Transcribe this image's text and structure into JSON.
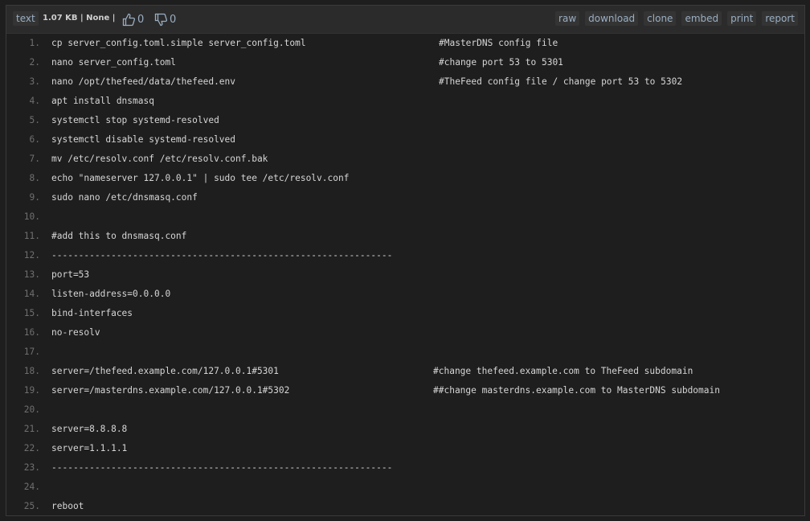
{
  "header": {
    "syntax_label": "text",
    "meta_text": "1.07 KB | None |",
    "like_count": "0",
    "dislike_count": "0",
    "actions": [
      "raw",
      "download",
      "clone",
      "embed",
      "print",
      "report"
    ]
  },
  "lines": [
    {
      "num": "1.",
      "code": "cp server_config.toml.simple server_config.toml",
      "comment": "#MasterDNS config file"
    },
    {
      "num": "2.",
      "code": "nano server_config.toml",
      "comment": "#change port 53 to 5301"
    },
    {
      "num": "3.",
      "code": "nano /opt/thefeed/data/thefeed.env",
      "comment": "#TheFeed config file / change port 53 to 5302"
    },
    {
      "num": "4.",
      "code": "apt install dnsmasq",
      "comment": ""
    },
    {
      "num": "5.",
      "code": "systemctl stop systemd-resolved",
      "comment": ""
    },
    {
      "num": "6.",
      "code": "systemctl disable systemd-resolved",
      "comment": ""
    },
    {
      "num": "7.",
      "code": "mv /etc/resolv.conf /etc/resolv.conf.bak",
      "comment": ""
    },
    {
      "num": "8.",
      "code": "echo \"nameserver 127.0.0.1\" | sudo tee /etc/resolv.conf",
      "comment": ""
    },
    {
      "num": "9.",
      "code": "sudo nano /etc/dnsmasq.conf",
      "comment": ""
    },
    {
      "num": "10.",
      "code": "",
      "comment": ""
    },
    {
      "num": "11.",
      "code": "#add this to dnsmasq.conf",
      "comment": ""
    },
    {
      "num": "12.",
      "code": "---------------------------------------------------------------",
      "comment": ""
    },
    {
      "num": "13.",
      "code": "port=53",
      "comment": ""
    },
    {
      "num": "14.",
      "code": "listen-address=0.0.0.0",
      "comment": ""
    },
    {
      "num": "15.",
      "code": "bind-interfaces",
      "comment": ""
    },
    {
      "num": "16.",
      "code": "no-resolv",
      "comment": ""
    },
    {
      "num": "17.",
      "code": "",
      "comment": ""
    },
    {
      "num": "18.",
      "code": "server=/thefeed.example.com/127.0.0.1#5301",
      "comment": "#change thefeed.example.com to TheFeed subdomain"
    },
    {
      "num": "19.",
      "code": "server=/masterdns.example.com/127.0.0.1#5302",
      "comment": "##change masterdns.example.com to MasterDNS subdomain"
    },
    {
      "num": "20.",
      "code": "",
      "comment": ""
    },
    {
      "num": "21.",
      "code": "server=8.8.8.8",
      "comment": ""
    },
    {
      "num": "22.",
      "code": "server=1.1.1.1",
      "comment": ""
    },
    {
      "num": "23.",
      "code": "---------------------------------------------------------------",
      "comment": ""
    },
    {
      "num": "24.",
      "code": "",
      "comment": ""
    },
    {
      "num": "25.",
      "code": "reboot",
      "comment": ""
    }
  ]
}
